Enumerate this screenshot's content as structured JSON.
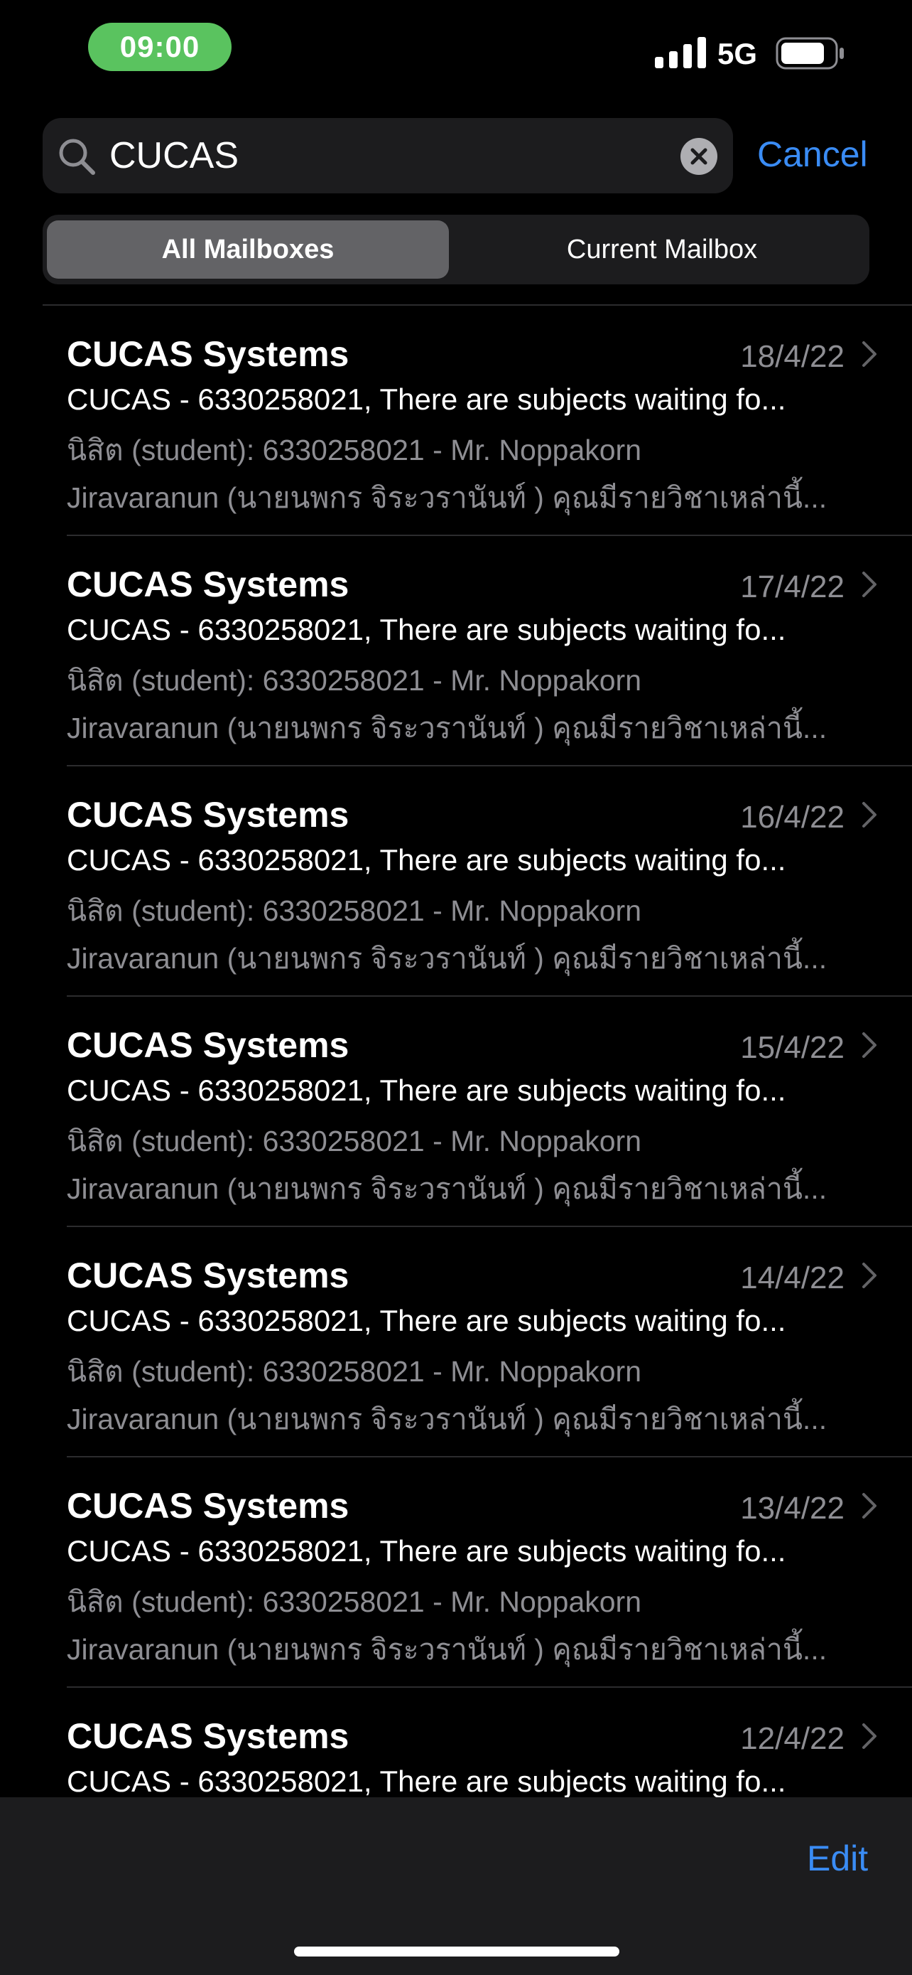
{
  "status_bar": {
    "time": "09:00",
    "network": "5G",
    "colors": {
      "time_pill": "#5ac35f"
    }
  },
  "search": {
    "query": "CUCAS",
    "cancel_label": "Cancel"
  },
  "scope": {
    "options": [
      "All Mailboxes",
      "Current Mailbox"
    ],
    "selected": "All Mailboxes"
  },
  "messages": [
    {
      "sender": "CUCAS Systems",
      "date": "18/4/22",
      "subject": "CUCAS - 6330258021, There are subjects waiting fo...",
      "preview_line1": "นิสิต (student): 6330258021 - Mr. Noppakorn",
      "preview_line2": "Jiravaranun (นายนพกร จิระวรานันท์ ) คุณมีรายวิชาเหล่านี้..."
    },
    {
      "sender": "CUCAS Systems",
      "date": "17/4/22",
      "subject": "CUCAS - 6330258021, There are subjects waiting fo...",
      "preview_line1": "นิสิต (student): 6330258021 - Mr. Noppakorn",
      "preview_line2": "Jiravaranun (นายนพกร จิระวรานันท์ ) คุณมีรายวิชาเหล่านี้..."
    },
    {
      "sender": "CUCAS Systems",
      "date": "16/4/22",
      "subject": "CUCAS - 6330258021, There are subjects waiting fo...",
      "preview_line1": "นิสิต (student): 6330258021 - Mr. Noppakorn",
      "preview_line2": "Jiravaranun (นายนพกร จิระวรานันท์ ) คุณมีรายวิชาเหล่านี้..."
    },
    {
      "sender": "CUCAS Systems",
      "date": "15/4/22",
      "subject": "CUCAS - 6330258021, There are subjects waiting fo...",
      "preview_line1": "นิสิต (student): 6330258021 - Mr. Noppakorn",
      "preview_line2": "Jiravaranun (นายนพกร จิระวรานันท์ ) คุณมีรายวิชาเหล่านี้..."
    },
    {
      "sender": "CUCAS Systems",
      "date": "14/4/22",
      "subject": "CUCAS - 6330258021, There are subjects waiting fo...",
      "preview_line1": "นิสิต (student): 6330258021 - Mr. Noppakorn",
      "preview_line2": "Jiravaranun (นายนพกร จิระวรานันท์ ) คุณมีรายวิชาเหล่านี้..."
    },
    {
      "sender": "CUCAS Systems",
      "date": "13/4/22",
      "subject": "CUCAS - 6330258021, There are subjects waiting fo...",
      "preview_line1": "นิสิต (student): 6330258021 - Mr. Noppakorn",
      "preview_line2": "Jiravaranun (นายนพกร จิระวรานันท์ ) คุณมีรายวิชาเหล่านี้..."
    },
    {
      "sender": "CUCAS Systems",
      "date": "12/4/22",
      "subject": "CUCAS - 6330258021, There are subjects waiting fo...",
      "preview_line1": "",
      "preview_line2": ""
    }
  ],
  "toolbar": {
    "edit_label": "Edit"
  },
  "colors": {
    "background": "#000000",
    "accent": "#3a8cf5",
    "secondary_text": "#8e8e93",
    "field_background": "#1c1c1e",
    "selected_segment": "#636366"
  }
}
